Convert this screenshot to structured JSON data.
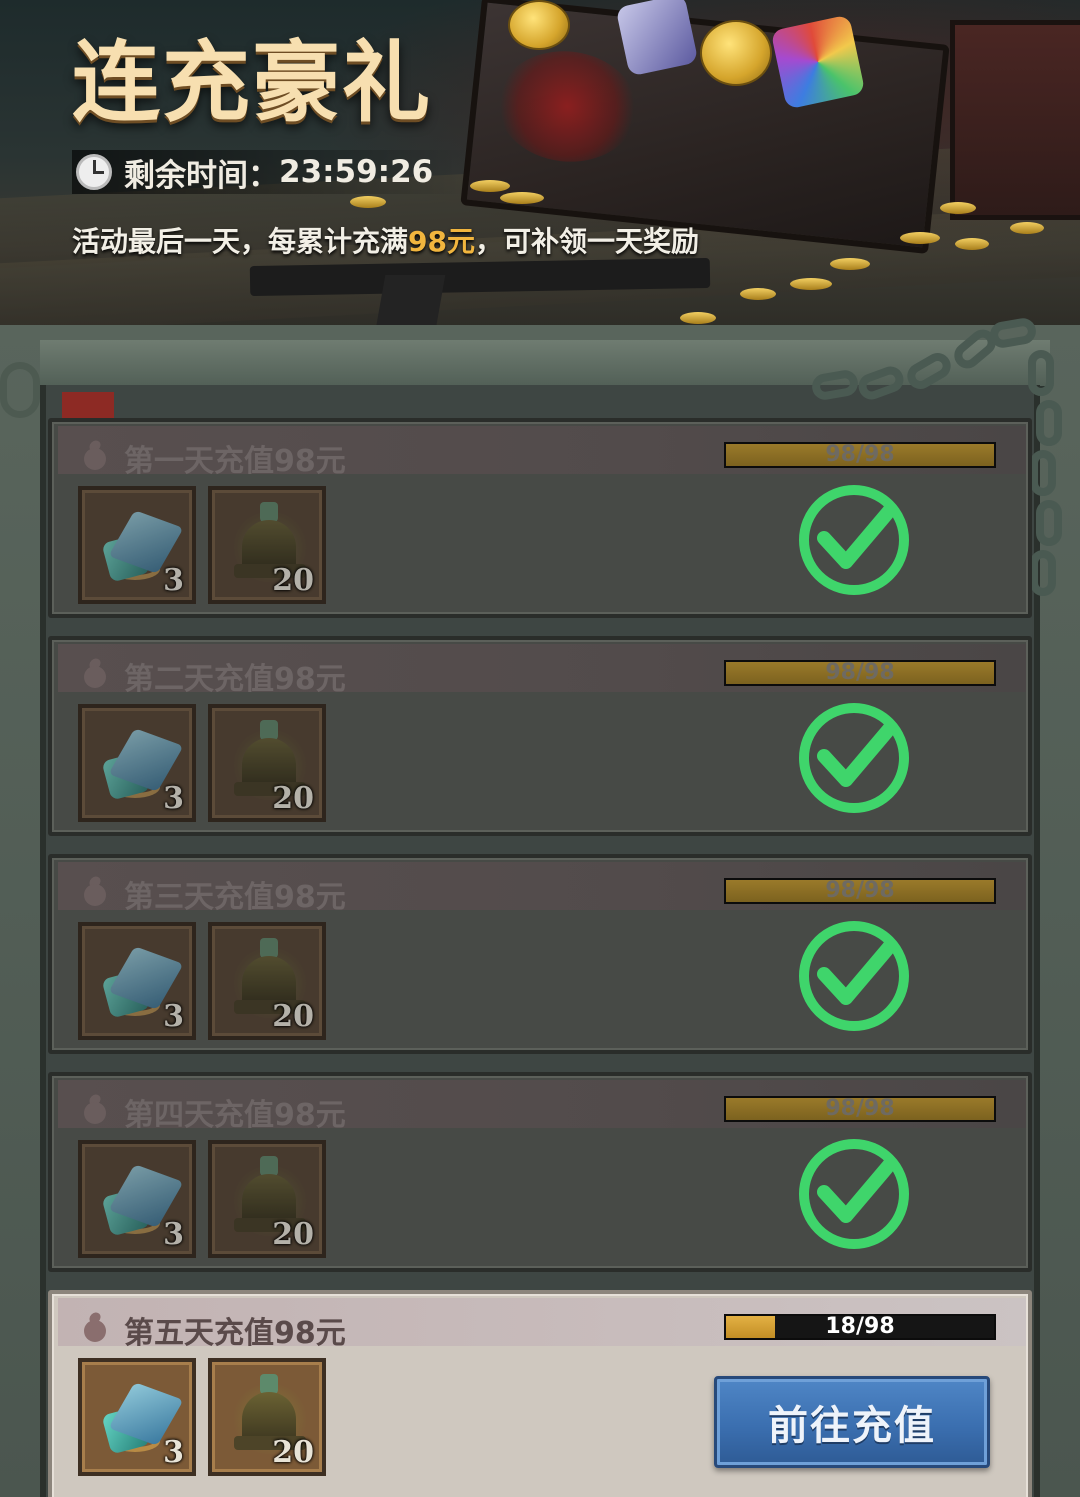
{
  "header": {
    "title": "连充豪礼",
    "timer_label": "剩余时间：",
    "timer_value": "23:59:26",
    "notice_prefix": "活动最后一天，每累计充满",
    "notice_amount": "98元",
    "notice_suffix": "，可补领一天奖励"
  },
  "colors": {
    "highlight": "#f1b53e",
    "check_green": "#3fd56b",
    "button_blue": "#3b6fb0"
  },
  "rows": [
    {
      "title": "第一天充值98元",
      "progress": "98/98",
      "progress_fraction": 1.0,
      "items": [
        {
          "icon": "crystal-icon",
          "count": "3"
        },
        {
          "icon": "bell-icon",
          "count": "20"
        }
      ],
      "status": "claimed"
    },
    {
      "title": "第二天充值98元",
      "progress": "98/98",
      "progress_fraction": 1.0,
      "items": [
        {
          "icon": "crystal-icon",
          "count": "3"
        },
        {
          "icon": "bell-icon",
          "count": "20"
        }
      ],
      "status": "claimed"
    },
    {
      "title": "第三天充值98元",
      "progress": "98/98",
      "progress_fraction": 1.0,
      "items": [
        {
          "icon": "crystal-icon",
          "count": "3"
        },
        {
          "icon": "bell-icon",
          "count": "20"
        }
      ],
      "status": "claimed"
    },
    {
      "title": "第四天充值98元",
      "progress": "98/98",
      "progress_fraction": 1.0,
      "items": [
        {
          "icon": "crystal-icon",
          "count": "3"
        },
        {
          "icon": "bell-icon",
          "count": "20"
        }
      ],
      "status": "claimed"
    },
    {
      "title": "第五天充值98元",
      "progress": "18/98",
      "progress_fraction": 0.184,
      "items": [
        {
          "icon": "crystal-icon",
          "count": "3"
        },
        {
          "icon": "bell-icon",
          "count": "20"
        }
      ],
      "status": "active",
      "button_label": "前往充值"
    }
  ]
}
